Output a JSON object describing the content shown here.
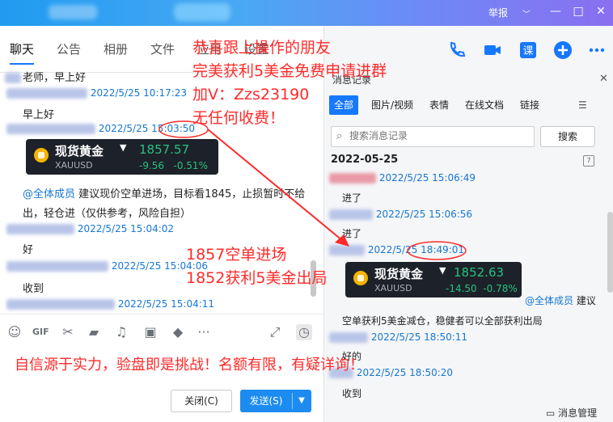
{
  "titlebar": {
    "report": "举报"
  },
  "left": {
    "tabs": [
      "聊天",
      "公告",
      "相册",
      "文件",
      "应用",
      "设置"
    ],
    "messages": [
      {
        "text": "老师，早上好"
      },
      {
        "time": "2022/5/25 10:17:23"
      },
      {
        "text": "早上好"
      },
      {
        "time": "2022/5/25 15:03:50"
      },
      {
        "mention": "@全体成员",
        "text": " 建议现价空单进场，目标看1845，止损暂时不给"
      },
      {
        "text": "出，轻仓进（仅供参考，风险自担）"
      },
      {
        "time": "2022/5/25 15:04:02"
      },
      {
        "text": "好"
      },
      {
        "time": "2022/5/25 15:04:06"
      },
      {
        "text": "收到"
      },
      {
        "time": "2022/5/25 15:04:11"
      }
    ],
    "card": {
      "name": "现货黄金",
      "code": "XAUUSD",
      "price": "1857.57",
      "change": "-9.56",
      "pct": "-0.51%"
    },
    "buttons": {
      "close": "关闭(C)",
      "send": "发送(S)"
    }
  },
  "right": {
    "panel_title": "消息记录",
    "filters": [
      "全部",
      "图片/视频",
      "表情",
      "在线文档",
      "链接"
    ],
    "search_placeholder": "搜索消息记录",
    "search_button": "搜索",
    "date": "2022-05-25",
    "records": [
      {
        "time": "2022/5/25 15:06:49"
      },
      {
        "text": "进了"
      },
      {
        "time": "2022/5/25 15:06:56"
      },
      {
        "text": "进了"
      },
      {
        "time": "2022/5/25 18:49:01"
      },
      {
        "mention": "@全体成员",
        "text": " 建议"
      },
      {
        "text": "空单获利5美金减仓，稳健者可以全部获利出局"
      },
      {
        "time": "2022/5/25 18:50:11"
      },
      {
        "text": "好的"
      },
      {
        "time": "2022/5/25 18:50:20"
      },
      {
        "text": "收到"
      }
    ],
    "card": {
      "name": "现货黄金",
      "code": "XAUUSD",
      "price": "1852.63",
      "change": "-14.50",
      "pct": "-0.78%"
    },
    "manage": "消息管理"
  },
  "annotations": {
    "line1": "恭喜跟上操作的朋友",
    "line2": "完美获利5美金免费申请进群",
    "line3": "加V：Zzs23190",
    "line4": "无任何收费！",
    "mid1": "1857空单进场",
    "mid2": "1852获利5美金出局",
    "bottom": "自信源于实力，验盘即是挑战！名额有限，有疑详询！"
  },
  "colors": {
    "accent": "#1677ff",
    "annotation": "#ff2a2a",
    "card_bg": "#1d2129",
    "up_green": "#27c281"
  }
}
